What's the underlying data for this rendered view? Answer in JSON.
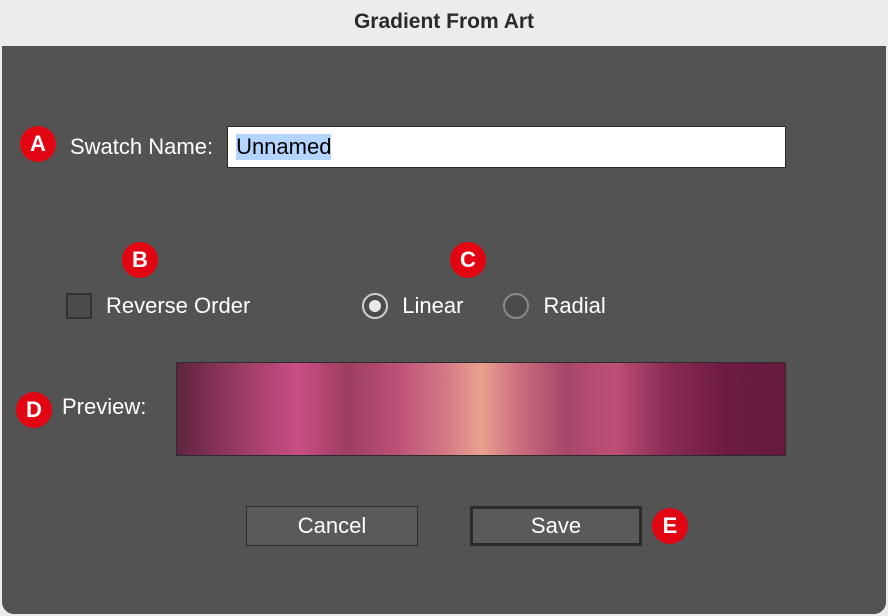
{
  "dialog": {
    "title": "Gradient From Art",
    "callouts": {
      "a": "A",
      "b": "B",
      "c": "C",
      "d": "D",
      "e": "E"
    },
    "swatch_label": "Swatch Name:",
    "swatch_value": "Unnamed",
    "reverse_label": "Reverse Order",
    "reverse_checked": false,
    "linear_label": "Linear",
    "radial_label": "Radial",
    "gradient_type_selected": "linear",
    "preview_label": "Preview:",
    "cancel_label": "Cancel",
    "save_label": "Save",
    "gradient_colors": [
      "#5f2440",
      "#a33e68",
      "#c94f84",
      "#9e3d62",
      "#bb4f77",
      "#d37886",
      "#eaa18e",
      "#cd6f7e",
      "#a8456b",
      "#be5078",
      "#8c2d55",
      "#6f1b41",
      "#651a3c"
    ]
  }
}
